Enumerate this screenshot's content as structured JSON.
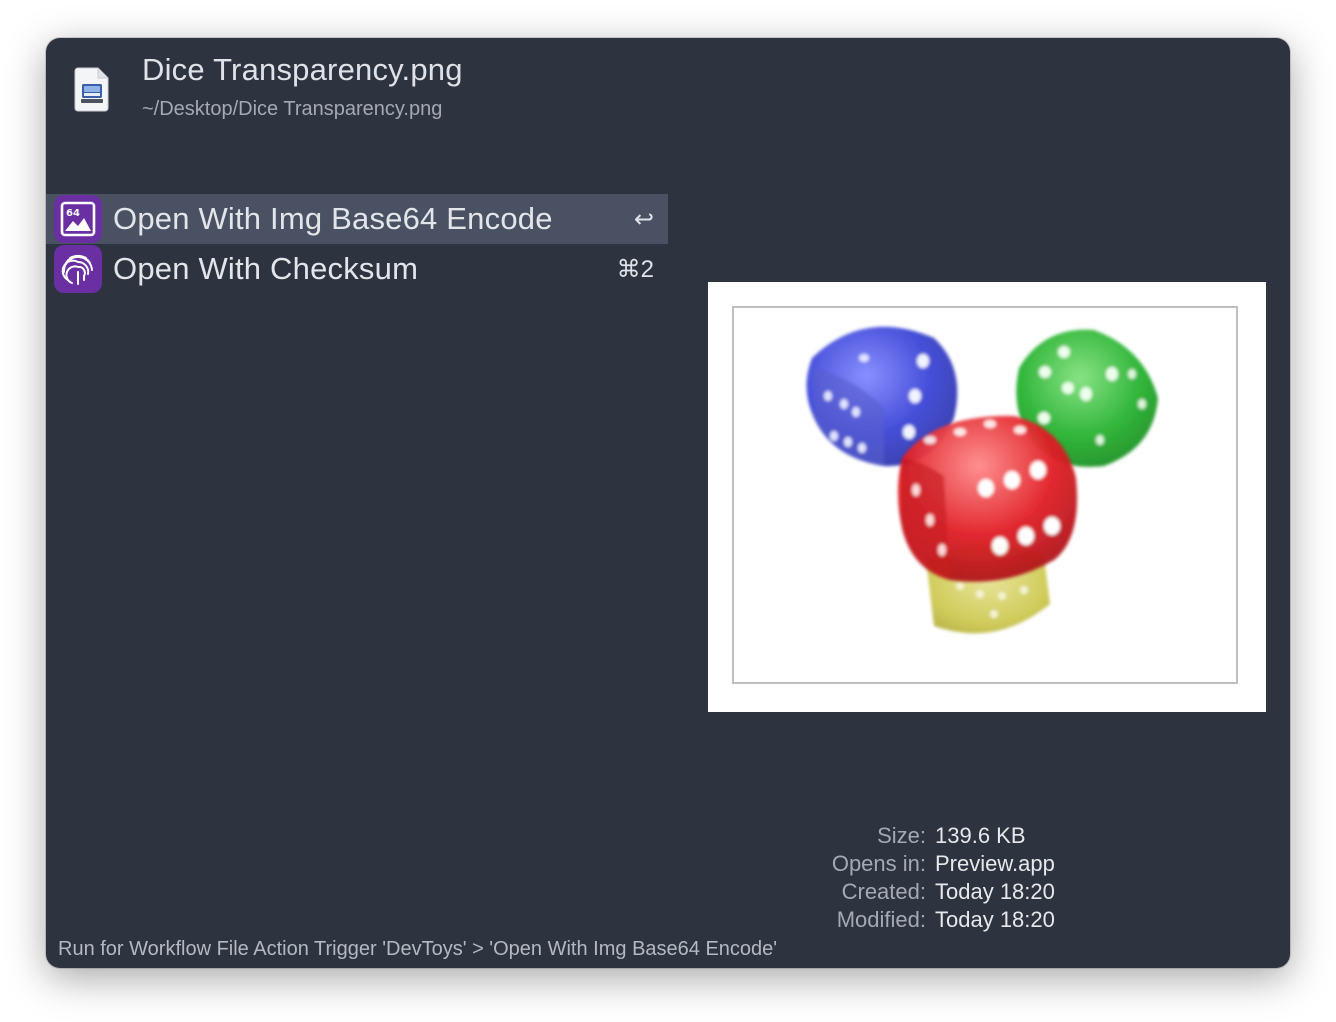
{
  "header": {
    "title": "Dice Transparency.png",
    "path": "~/Desktop/Dice Transparency.png",
    "icon": "png-file-icon"
  },
  "actions": [
    {
      "label": "Open With Img Base64 Encode",
      "shortcut": "↩",
      "icon": "image-base64-icon",
      "selected": true
    },
    {
      "label": "Open With Checksum",
      "shortcut": "⌘2",
      "icon": "fingerprint-icon",
      "selected": false
    }
  ],
  "preview": {
    "content": "four translucent dice: blue, green, red, yellow"
  },
  "meta": {
    "size_label": "Size:",
    "size": "139.6 KB",
    "opens_label": "Opens in:",
    "opens": "Preview.app",
    "created_label": "Created:",
    "created": "Today 18:20",
    "modified_label": "Modified:",
    "modified": "Today 18:20"
  },
  "footer": {
    "text": "Run for Workflow File Action Trigger 'DevToys' > 'Open With Img Base64 Encode'"
  },
  "colors": {
    "window_bg": "#2e3340",
    "selected_row": "#4a5162",
    "app_icon_bg": "#6a2fa3"
  }
}
